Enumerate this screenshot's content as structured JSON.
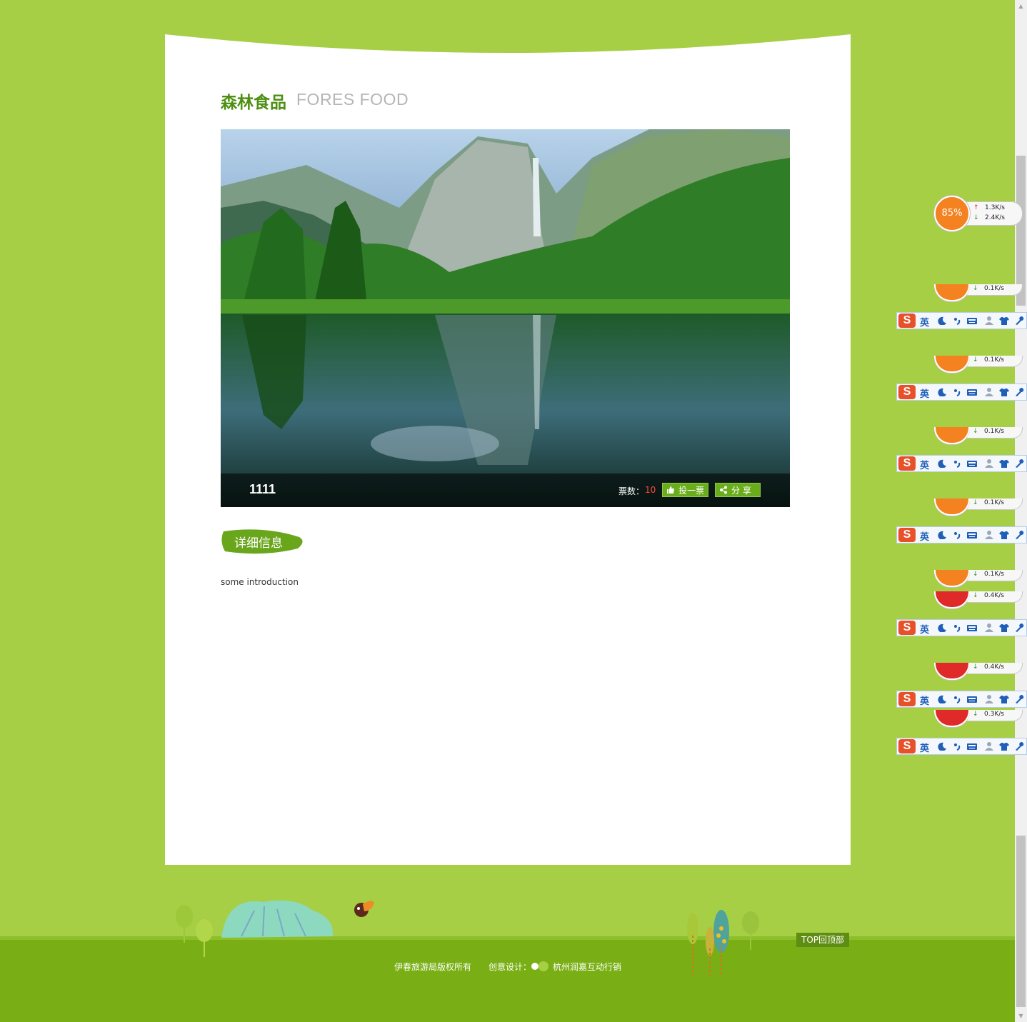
{
  "header": {
    "title_cn": "森林食品",
    "title_en": "FORES FOOD"
  },
  "photo": {
    "name": "1111",
    "votes_label": "票数：",
    "votes_count": "10",
    "vote_button": "投一票",
    "share_button": "分 享"
  },
  "details": {
    "tab_label": "详细信息",
    "intro": "some introduction"
  },
  "footer": {
    "copyright": "伊春旅游局版权所有",
    "design_label": "创意设计：",
    "design_company": "杭州润嘉互动行销",
    "top_button": "TOP回顶部"
  },
  "widgets": {
    "net_monitor": {
      "percent": "85%",
      "upload": "1.3K/s",
      "download": "2.4K/s"
    },
    "ghost_rates": [
      "0.1K/s",
      "0.1K/s",
      "0.1K/s",
      "0.1K/s",
      "0.1K/s",
      "0.4K/s",
      "0.4K/s",
      "0.3K/s"
    ],
    "ime_label": "英",
    "ime_logo": "S"
  },
  "colors": {
    "background": "#a7cf45",
    "accent_green": "#4d8f12",
    "footer_green": "#79af15",
    "vote_count": "#ff4a3a"
  }
}
